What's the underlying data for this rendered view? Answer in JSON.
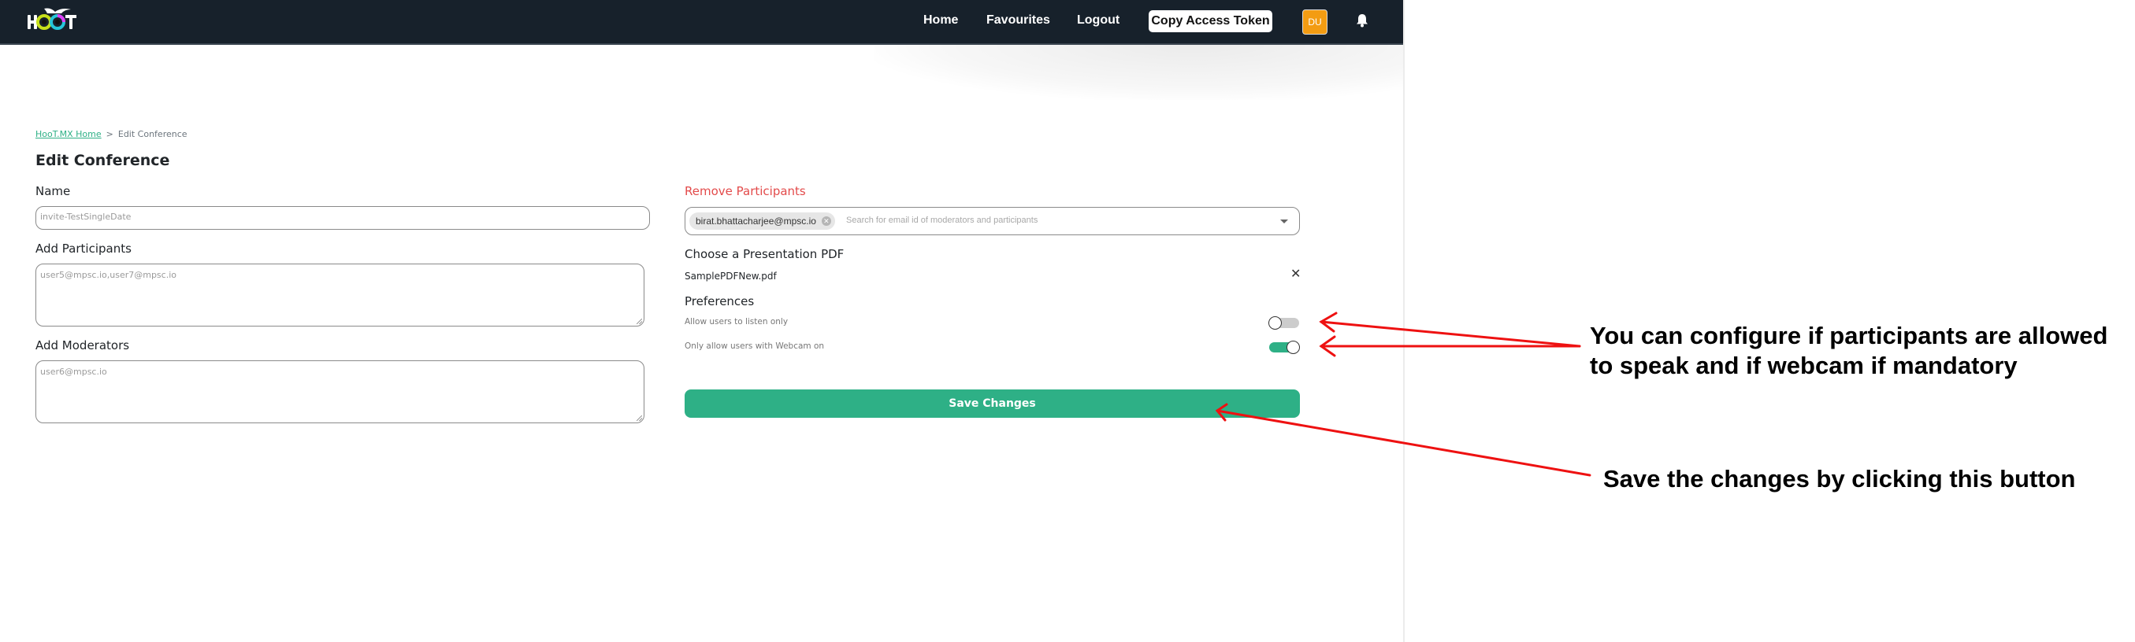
{
  "navbar": {
    "logo_text": "HOOT",
    "links": [
      "Home",
      "Favourites",
      "Logout"
    ],
    "copy_token_label": "Copy Access Token",
    "avatar_initials": "DU",
    "avatar_color": "#f39c12",
    "bell_icon": "bell-icon",
    "background_color": "#17212b"
  },
  "breadcrumb": {
    "home": "HooT.MX Home",
    "separator": ">",
    "current": "Edit Conference"
  },
  "page_title": "Edit Conference",
  "left_form": {
    "name_label": "Name",
    "name_placeholder": "invite-TestSingleDate",
    "participants_label": "Add Participants",
    "participants_placeholder": "user5@mpsc.io,user7@mpsc.io",
    "moderators_label": "Add Moderators",
    "moderators_placeholder": "user6@mpsc.io"
  },
  "right_form": {
    "remove_label": "Remove Participants",
    "remove_label_color": "#e34b4b",
    "selected_chips": [
      "birat.bhattacharjee@mpsc.io"
    ],
    "search_placeholder": "Search for email id of moderators and participants",
    "pdf_label": "Choose a Presentation PDF",
    "pdf_file": "SamplePDFNew.pdf",
    "preferences_label": "Preferences",
    "preferences": [
      {
        "label": "Allow users to listen only",
        "enabled": false
      },
      {
        "label": "Only allow users with Webcam on",
        "enabled": true
      }
    ],
    "save_label": "Save Changes",
    "accent_color": "#2eb086"
  },
  "annotations": {
    "config_note_line1": "You can configure if participants are allowed",
    "config_note_line2": "to speak and if webcam if mandatory",
    "save_note": "Save the changes by clicking this button",
    "arrow_color": "#ee1111"
  }
}
